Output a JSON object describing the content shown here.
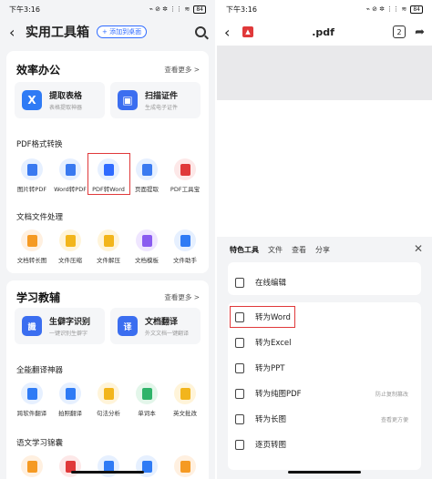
{
  "left": {
    "status": {
      "time": "下午3:16",
      "icons": "⌁ ⊘ ✲ ⋮⋮ ≋",
      "battery": "84"
    },
    "header": {
      "title": "实用工具箱",
      "add_label": "+ 添加到桌面"
    },
    "efficiency": {
      "title": "效率办公",
      "see_more": "查看更多 >",
      "features": [
        {
          "name": "提取表格",
          "desc": "表格提取神器",
          "icon": "X",
          "color": "#2f7bf5"
        },
        {
          "name": "扫描证件",
          "desc": "生成电子证件",
          "icon": "▣",
          "color": "#3b6ef0"
        }
      ],
      "pdf_section": "PDF格式转换",
      "pdf_tools": [
        {
          "label": "图片转PDF",
          "bg": "#e6f0ff",
          "fg": "#3a7af0"
        },
        {
          "label": "Word转PDF",
          "bg": "#e6f0ff",
          "fg": "#3a7af0"
        },
        {
          "label": "PDF转Word",
          "bg": "#e6f0ff",
          "fg": "#2f6bff"
        },
        {
          "label": "页面提取",
          "bg": "#e6f0ff",
          "fg": "#3a7af0"
        },
        {
          "label": "PDF工具宝",
          "bg": "#fde8e8",
          "fg": "#e0393a"
        }
      ],
      "doc_section": "文档文件处理",
      "doc_tools": [
        {
          "label": "文档转长图",
          "bg": "#fff0e0",
          "fg": "#f59a23"
        },
        {
          "label": "文件压缩",
          "bg": "#fff4d9",
          "fg": "#f2b51c"
        },
        {
          "label": "文件解压",
          "bg": "#fff4d9",
          "fg": "#f2b51c"
        },
        {
          "label": "文档模板",
          "bg": "#efe6ff",
          "fg": "#8a5cf0"
        },
        {
          "label": "文件助手",
          "bg": "#e6f0ff",
          "fg": "#2f7bf5"
        }
      ]
    },
    "study": {
      "title": "学习教辅",
      "see_more": "查看更多 >",
      "features": [
        {
          "name": "生僻字识别",
          "desc": "一键识别生僻字",
          "icon": "識",
          "color": "#3b6ef0"
        },
        {
          "name": "文档翻译",
          "desc": "外文文档一键翻译",
          "icon": "译",
          "color": "#3b6ef0"
        }
      ],
      "translate_section": "全能翻译神器",
      "translate_tools": [
        {
          "label": "跨软件翻译",
          "bg": "#e6f0ff",
          "fg": "#2f7bf5"
        },
        {
          "label": "拍照翻译",
          "bg": "#e6f0ff",
          "fg": "#2f7bf5"
        },
        {
          "label": "句法分析",
          "bg": "#fff4d9",
          "fg": "#f2b51c"
        },
        {
          "label": "单词本",
          "bg": "#e3f6ea",
          "fg": "#2fb36a"
        },
        {
          "label": "英文批改",
          "bg": "#fff4d9",
          "fg": "#f2b51c"
        }
      ],
      "chinese_section": "语文学习锦囊"
    }
  },
  "right": {
    "status": {
      "time": "下午3:16",
      "icons": "⌁ ⊘ ✲ ⋮⋮ ≋",
      "battery": "84"
    },
    "header": {
      "title": ".pdf",
      "pages": "2"
    },
    "tabs": [
      "特色工具",
      "文件",
      "查看",
      "分享"
    ],
    "close": "✕",
    "actions": [
      {
        "label": "在线编辑",
        "note": ""
      },
      {
        "label": "转为Word",
        "note": ""
      },
      {
        "label": "转为Excel",
        "note": ""
      },
      {
        "label": "转为PPT",
        "note": ""
      },
      {
        "label": "转为纯图PDF",
        "note": "防止复制篡改"
      },
      {
        "label": "转为长图",
        "note": "查看更方便"
      },
      {
        "label": "逐页转图",
        "note": ""
      }
    ]
  },
  "colors": {
    "accent": "#2f6bff",
    "highlight": "#e0393a"
  }
}
